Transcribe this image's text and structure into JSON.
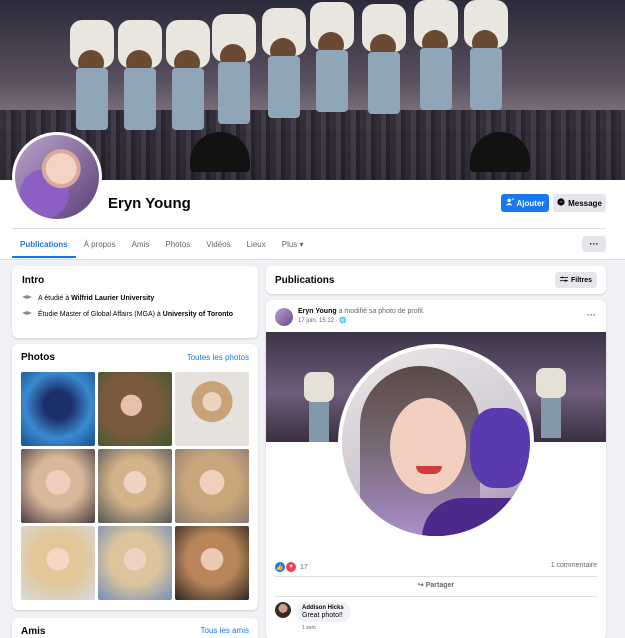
{
  "profile": {
    "name": "Eryn Young"
  },
  "actions": {
    "add_label": "Ajouter",
    "message_label": "Message",
    "more_label": "···"
  },
  "tabs": [
    {
      "label": "Publications"
    },
    {
      "label": "À propos"
    },
    {
      "label": "Amis"
    },
    {
      "label": "Photos"
    },
    {
      "label": "Vidéos"
    },
    {
      "label": "Lieux"
    },
    {
      "label": "Plus ▾"
    }
  ],
  "intro": {
    "title": "Intro",
    "items": [
      {
        "prefix": "A étudié à ",
        "bold": "Wilfrid Laurier University",
        "suffix": "",
        "bold2": ""
      },
      {
        "prefix": "Étudie Master of Global Affairs (MGA) à ",
        "bold": "University of Toronto",
        "suffix": "",
        "bold2": ""
      }
    ]
  },
  "photos": {
    "title": "Photos",
    "link": "Toutes les photos",
    "colors": [
      "#2a6fb0",
      "#8a6a4a",
      "#c9bfb5",
      "#d9b8a8",
      "#6a5a52",
      "#c6a98c",
      "#e2c9a8",
      "#5b7fa8",
      "#b88e6a"
    ]
  },
  "friends": {
    "title": "Amis",
    "link": "Tous les amis"
  },
  "publications": {
    "title": "Publications",
    "filter_label": "Filtres"
  },
  "post": {
    "author": "Eryn Young",
    "action": "a modifié sa photo de profil.",
    "time": "17 juin, 15:12 · ",
    "reactions_count": "17",
    "comments_count": "1 commentaire",
    "share_label": "Partager",
    "comment": {
      "author": "Addison Hicks",
      "text": "Great photo!!",
      "time": "1 sem"
    }
  }
}
